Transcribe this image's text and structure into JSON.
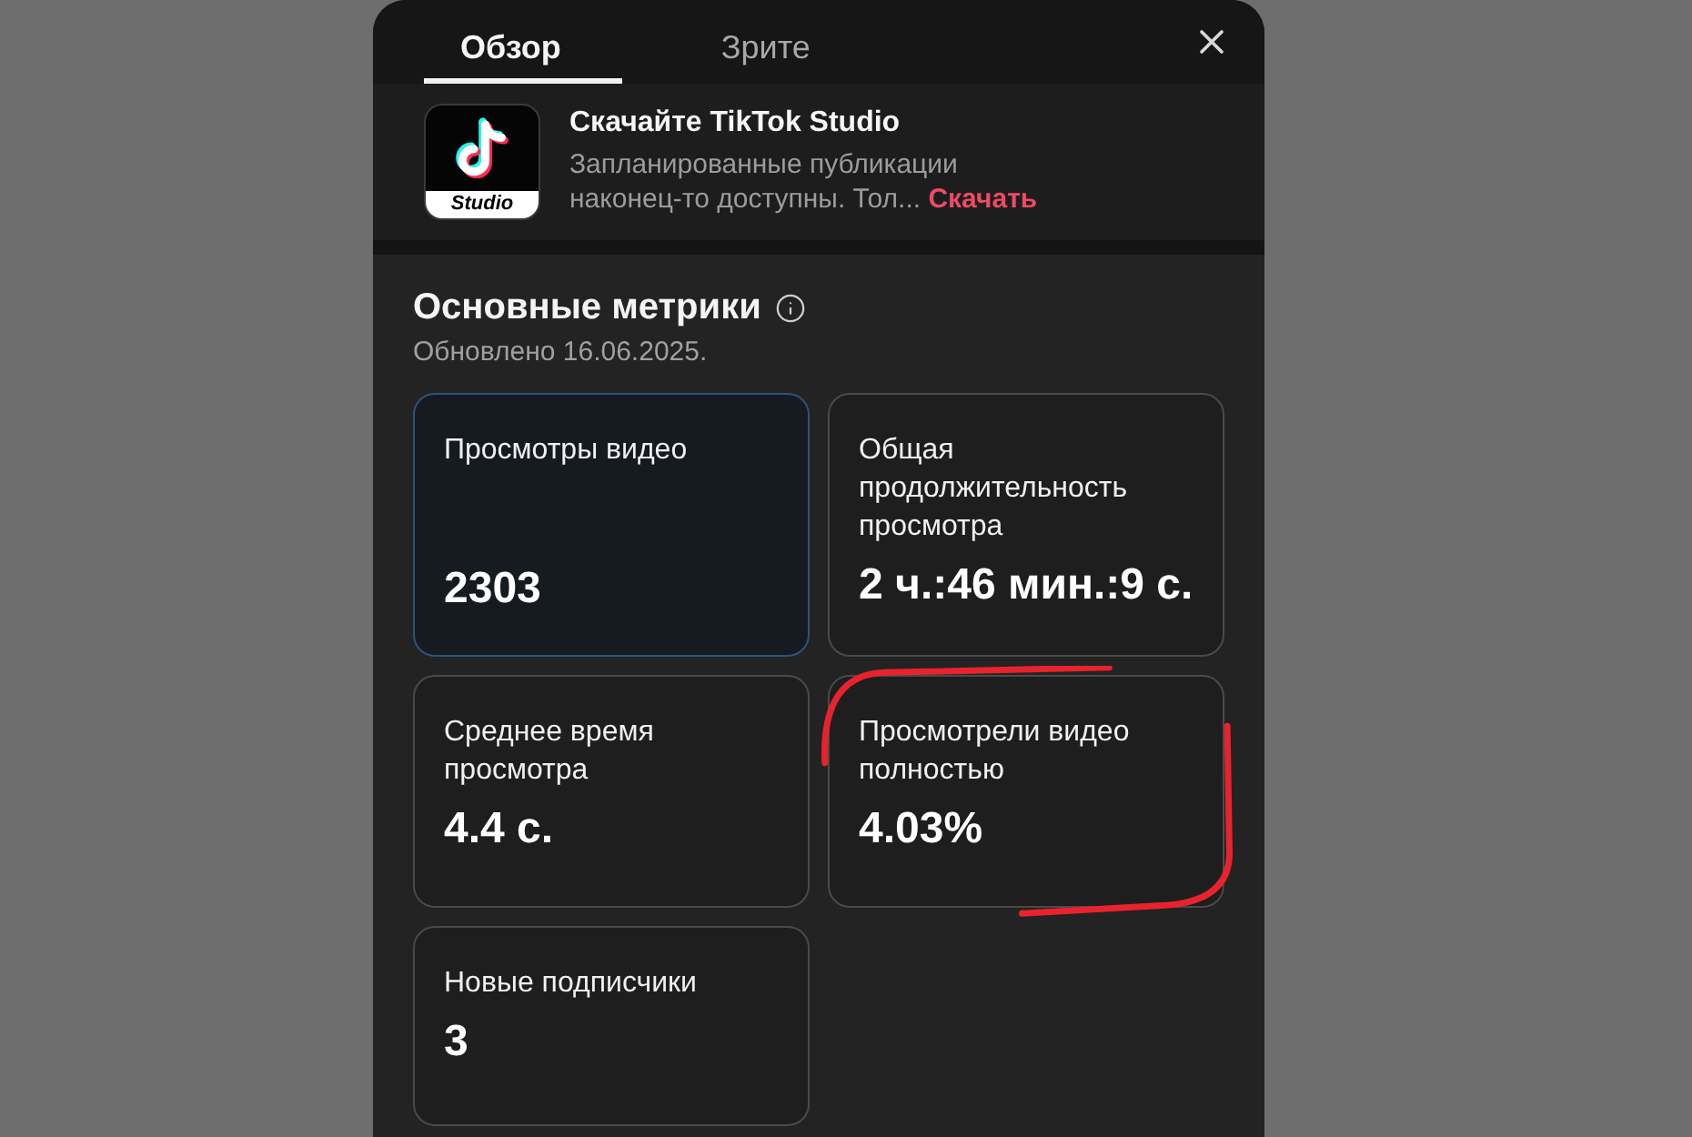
{
  "tabs": [
    {
      "label": "Обзор",
      "selected": true
    },
    {
      "label": "Зрите",
      "selected": false
    }
  ],
  "banner": {
    "title": "Скачайте TikTok Studio",
    "text": "Запланированные публикации наконец-то доступны. Тол...",
    "link": "Скачать",
    "logo_label": "Studio"
  },
  "metrics": {
    "title": "Основные метрики",
    "updated": "Обновлено 16.06.2025.",
    "cards": [
      {
        "label": "Просмотры видео",
        "value": "2303",
        "selected": true,
        "annotated": false
      },
      {
        "label": "Общая продолжительность просмотра",
        "value": "2 ч.:46 мин.:9 с.",
        "selected": false,
        "annotated": false
      },
      {
        "label": "Среднее время просмотра",
        "value": "4.4 с.",
        "selected": false,
        "annotated": false
      },
      {
        "label": "Просмотрели видео полностью",
        "value": "4.03%",
        "selected": false,
        "annotated": true
      },
      {
        "label": "Новые подписчики",
        "value": "3",
        "selected": false,
        "annotated": false
      }
    ]
  }
}
